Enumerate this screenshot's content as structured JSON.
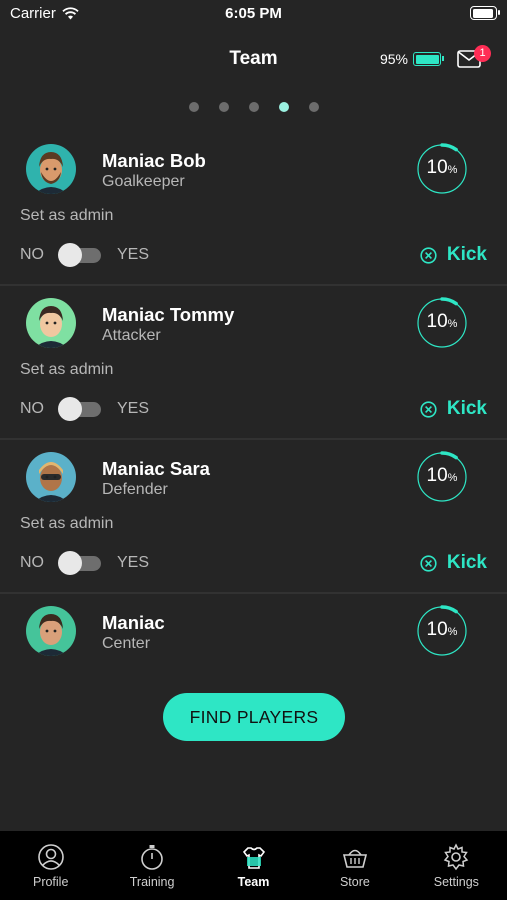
{
  "status_bar": {
    "carrier": "Carrier",
    "time": "6:05 PM"
  },
  "header": {
    "title": "Team",
    "battery_percent": "95%",
    "mail_badge": "1"
  },
  "pager": {
    "count": 5,
    "active_index": 3
  },
  "players": [
    {
      "name": "Maniac Bob",
      "role": "Goalkeeper",
      "progress_value": "10",
      "progress_unit": "%",
      "progress_fraction": 0.1,
      "admin_label": "Set as admin",
      "no_label": "NO",
      "yes_label": "YES",
      "admin": false,
      "kick_label": "Kick",
      "avatar_colors": {
        "bg": "#2fb3ad",
        "skin": "#d99a6c",
        "hair": "#5a3a22"
      }
    },
    {
      "name": "Maniac Tommy",
      "role": "Attacker",
      "progress_value": "10",
      "progress_unit": "%",
      "progress_fraction": 0.1,
      "admin_label": "Set as admin",
      "no_label": "NO",
      "yes_label": "YES",
      "admin": false,
      "kick_label": "Kick",
      "avatar_colors": {
        "bg": "#7fe0a2",
        "skin": "#f0c7a0",
        "hair": "#3a2a22"
      }
    },
    {
      "name": "Maniac Sara",
      "role": "Defender",
      "progress_value": "10",
      "progress_unit": "%",
      "progress_fraction": 0.1,
      "admin_label": "Set as admin",
      "no_label": "NO",
      "yes_label": "YES",
      "admin": false,
      "kick_label": "Kick",
      "avatar_colors": {
        "bg": "#5bb1c9",
        "skin": "#b07548",
        "hair": "#e3b66e"
      }
    },
    {
      "name": "Maniac",
      "role": "Center",
      "progress_value": "10",
      "progress_unit": "%",
      "progress_fraction": 0.1,
      "avatar_colors": {
        "bg": "#45c49a",
        "skin": "#d9a07a",
        "hair": "#3a2a1e"
      }
    }
  ],
  "find_players_label": "FIND PLAYERS",
  "tabs": [
    {
      "label": "Profile",
      "icon": "profile-icon"
    },
    {
      "label": "Training",
      "icon": "stopwatch-icon"
    },
    {
      "label": "Team",
      "icon": "jersey-icon",
      "active": true
    },
    {
      "label": "Store",
      "icon": "basket-icon"
    },
    {
      "label": "Settings",
      "icon": "gear-icon"
    }
  ],
  "colors": {
    "accent": "#2ee6c5",
    "background": "#252525",
    "badge": "#ff2d55"
  }
}
